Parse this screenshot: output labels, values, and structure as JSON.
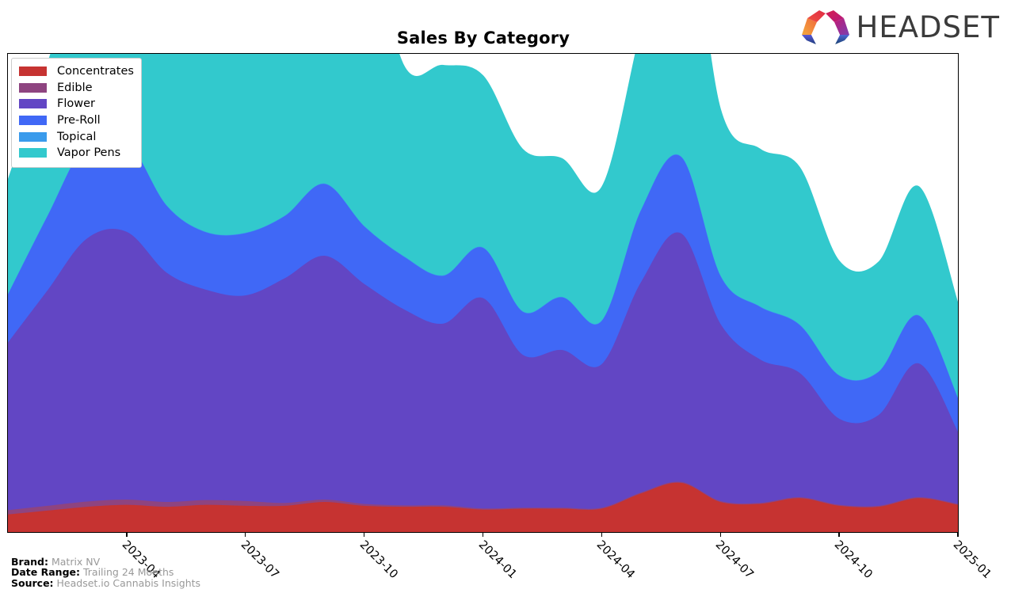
{
  "header": {
    "title": "Sales By Category",
    "logo_text": "HEADSET",
    "logo_mark": "headset-logo-icon"
  },
  "footer": {
    "rows": [
      {
        "key": "Brand:",
        "value": "Matrix NV"
      },
      {
        "key": "Date Range:",
        "value": "Trailing 24 Months"
      },
      {
        "key": "Source:",
        "value": "Headset.io Cannabis Insights"
      }
    ]
  },
  "legend": {
    "position": "upper-left",
    "items": [
      {
        "label": "Concentrates",
        "color": "#c63331"
      },
      {
        "label": "Edible",
        "color": "#8e4480"
      },
      {
        "label": "Flower",
        "color": "#6246c4"
      },
      {
        "label": "Pre-Roll",
        "color": "#4068f6"
      },
      {
        "label": "Topical",
        "color": "#3a9bec"
      },
      {
        "label": "Vapor Pens",
        "color": "#32c9cd"
      }
    ]
  },
  "chart_data": {
    "type": "area",
    "stacked": true,
    "title": "Sales By Category",
    "xlabel": "",
    "ylabel": "",
    "grid": false,
    "legend_position": "upper-left",
    "axis": {
      "x_tick_labels": [
        "2023-04",
        "2023-07",
        "2023-10",
        "2024-01",
        "2024-04",
        "2024-07",
        "2024-10",
        "2025-01"
      ],
      "x_tick_rotation": 45,
      "y_tick_labels": [],
      "ylim": [
        0,
        100
      ]
    },
    "x": [
      "2023-01",
      "2023-02",
      "2023-03",
      "2023-04",
      "2023-05",
      "2023-06",
      "2023-07",
      "2023-08",
      "2023-09",
      "2023-10",
      "2023-11",
      "2023-12",
      "2024-01",
      "2024-02",
      "2024-03",
      "2024-04",
      "2024-05",
      "2024-06",
      "2024-07",
      "2024-08",
      "2024-09",
      "2024-10",
      "2024-11",
      "2024-12",
      "2025-01"
    ],
    "series": [
      {
        "name": "Concentrates",
        "color": "#c63331",
        "values": [
          3.6,
          4.4,
          5.2,
          5.6,
          5.2,
          5.6,
          5.4,
          5.4,
          6.2,
          5.4,
          5.2,
          5.2,
          4.6,
          4.8,
          4.8,
          4.8,
          8.0,
          10.2,
          6.2,
          5.8,
          7.0,
          5.4,
          5.2,
          7.0,
          5.6
        ]
      },
      {
        "name": "Edible",
        "color": "#8e4480",
        "values": [
          0.9,
          1.0,
          1.1,
          1.1,
          1.0,
          1.0,
          1.0,
          0.6,
          0.5,
          0.4,
          0.3,
          0.3,
          0.25,
          0.2,
          0.2,
          0.2,
          0.2,
          0.2,
          0.2,
          0.2,
          0.2,
          0.2,
          0.2,
          0.2,
          0.2
        ]
      },
      {
        "name": "Flower",
        "color": "#6246c4",
        "values": [
          35.0,
          45.0,
          55.0,
          56.0,
          48.0,
          44.0,
          43.0,
          47.0,
          51.0,
          46.0,
          41.0,
          38.0,
          44.0,
          32.0,
          33.0,
          30.0,
          44.0,
          52.0,
          37.0,
          30.0,
          26.0,
          18.0,
          19.0,
          28.0,
          15.0
        ]
      },
      {
        "name": "Pre-Roll",
        "color": "#4068f6",
        "values": [
          10.0,
          15.5,
          20.0,
          19.0,
          14.0,
          12.0,
          13.0,
          13.0,
          15.0,
          12.0,
          11.0,
          10.0,
          10.5,
          9.0,
          11.0,
          9.0,
          15.0,
          16.0,
          10.0,
          11.0,
          10.0,
          9.0,
          9.0,
          10.0,
          7.0
        ]
      },
      {
        "name": "Topical",
        "color": "#3a9bec",
        "values": [
          0.1,
          0.1,
          0.1,
          0.1,
          0.1,
          0.1,
          0.1,
          0.1,
          0.1,
          0.1,
          0.1,
          0.1,
          0.1,
          0.1,
          0.1,
          0.1,
          0.1,
          0.1,
          0.1,
          0.1,
          0.1,
          0.1,
          0.1,
          0.1,
          0.1
        ]
      },
      {
        "name": "Vapor Pens",
        "color": "#32c9cd",
        "values": [
          24.0,
          32.0,
          40.0,
          38.0,
          40.0,
          47.0,
          50.0,
          58.0,
          80.0,
          66.0,
          40.0,
          44.0,
          36.0,
          34.0,
          29.0,
          28.0,
          38.0,
          59.0,
          35.0,
          33.0,
          33.0,
          24.0,
          23.0,
          27.0,
          20.0
        ]
      }
    ]
  }
}
